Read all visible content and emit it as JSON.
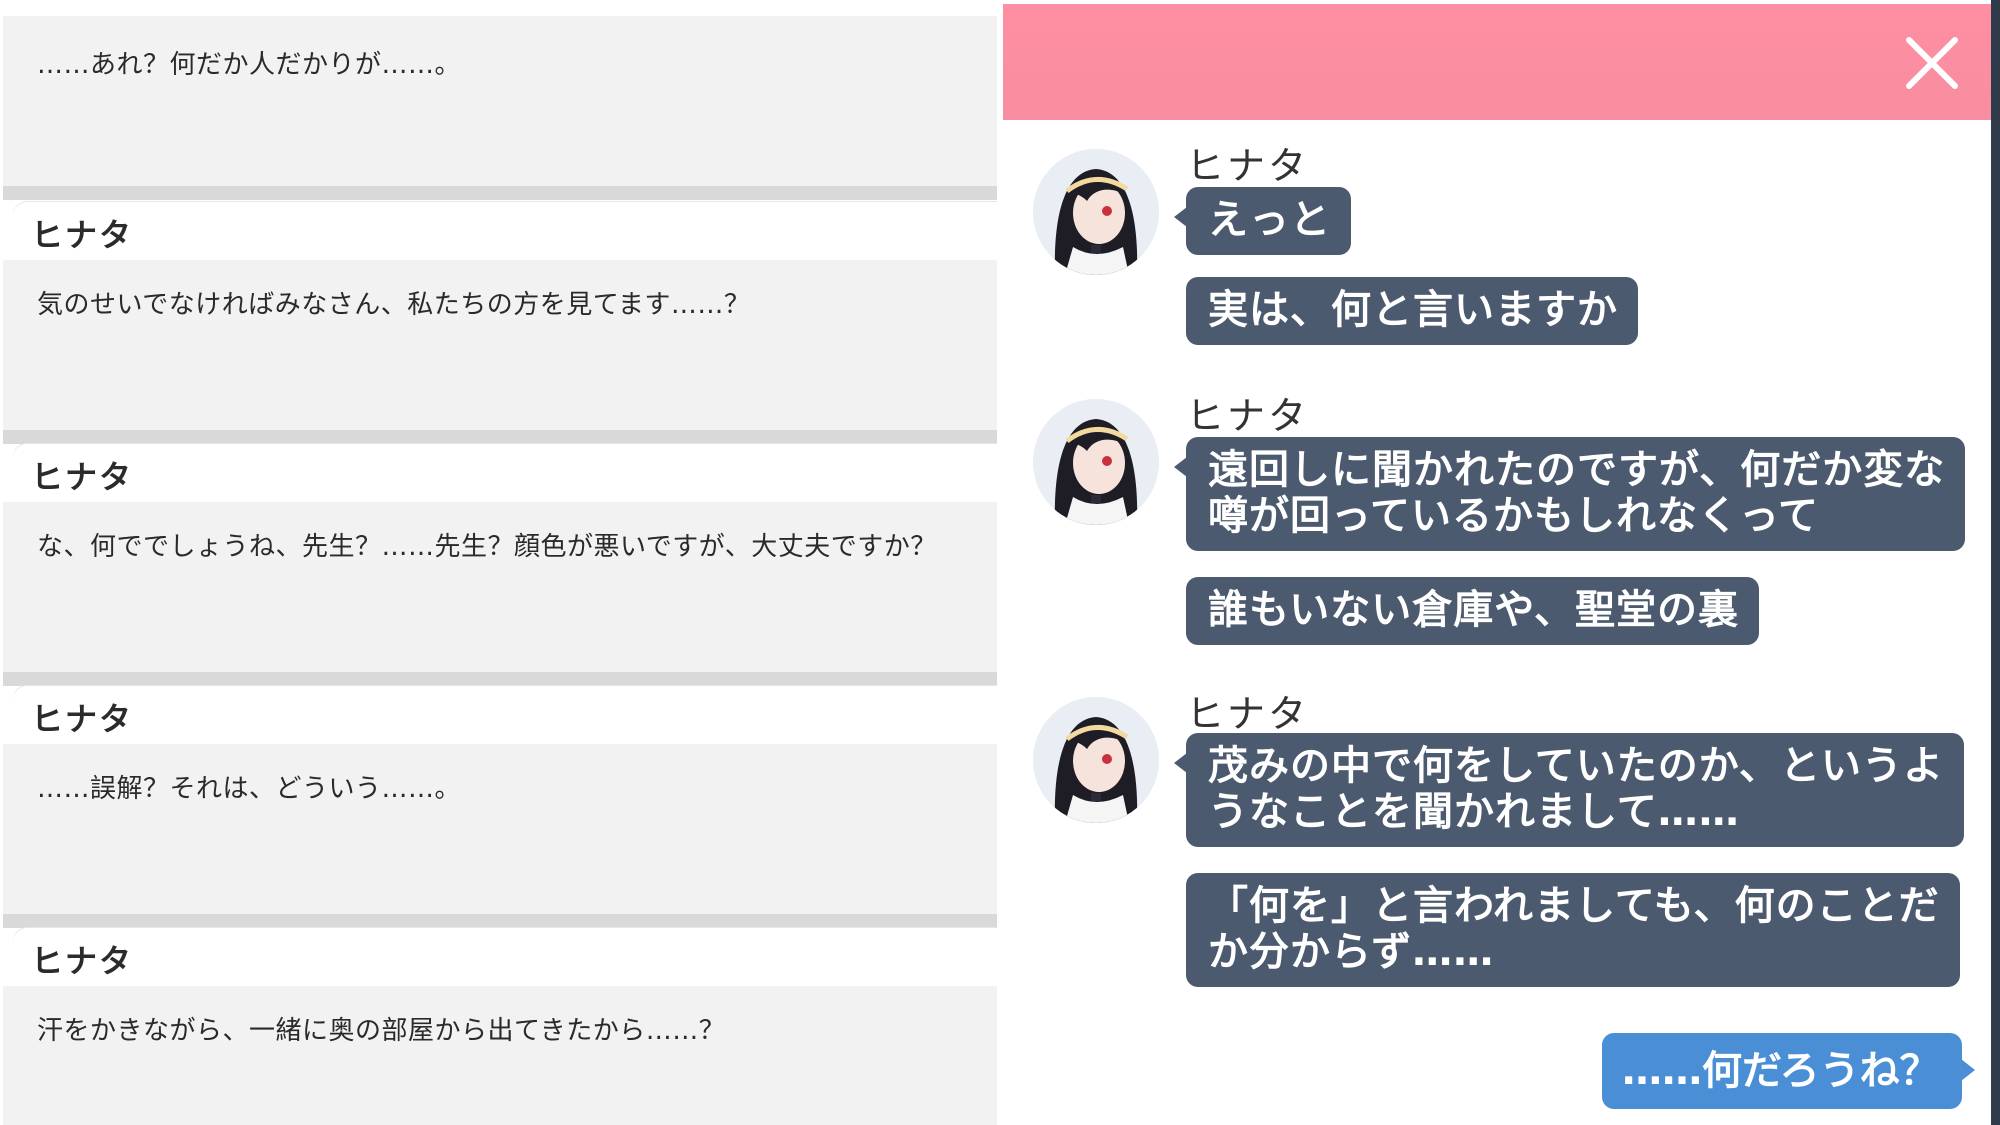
{
  "log": {
    "entries": [
      {
        "name": "",
        "text": "……あれ？何だか人だかりが……。"
      },
      {
        "name": "ヒナタ",
        "text": "気のせいでなければみなさん、私たちの方を見てます……？"
      },
      {
        "name": "ヒナタ",
        "text": "な、何ででしょうね、先生？……先生？顔色が悪いですが、大丈夫ですか？"
      },
      {
        "name": "ヒナタ",
        "text": "……誤解？それは、どういう……。"
      },
      {
        "name": "ヒナタ",
        "text": "汗をかきながら、一緒に奥の部屋から出てきたから……？"
      }
    ]
  },
  "chat": {
    "header_color": "#f78da0",
    "close_icon": "close-icon",
    "groups": [
      {
        "sender": "ヒナタ",
        "messages": [
          "えっと",
          "実は、何と言いますか"
        ]
      },
      {
        "sender": "ヒナタ",
        "messages": [
          "遠回しに聞かれたのですが、何だか変な\n噂が回っているかもしれなくって",
          "誰もいない倉庫や、聖堂の裏"
        ]
      },
      {
        "sender": "ヒナタ",
        "messages": [
          "茂みの中で何をしていたのか、というよ\nうなことを聞かれまして……",
          "「何を」と言われましても、何のことだ\nか分からず……"
        ]
      }
    ],
    "reply": "……何だろうね？",
    "colors": {
      "npc_bubble": "#4b5a6e",
      "reply_bubble": "#4a8fd6"
    }
  }
}
